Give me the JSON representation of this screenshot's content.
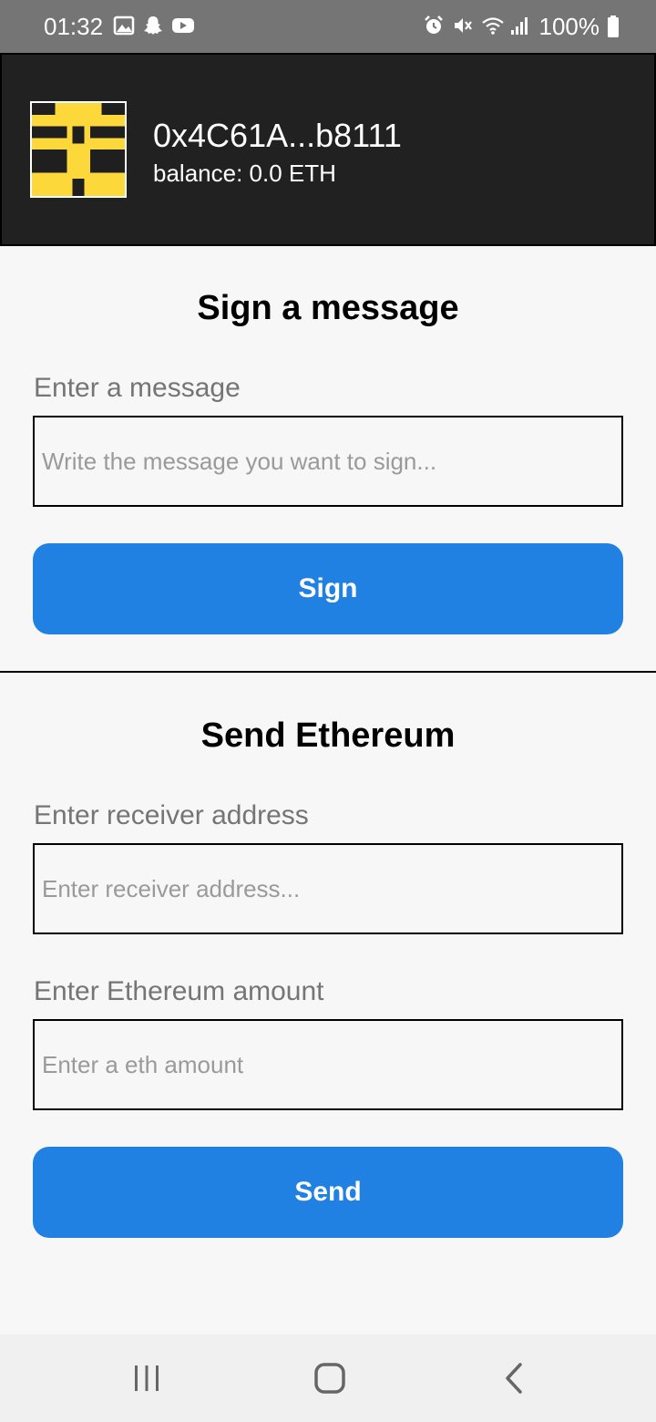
{
  "status_bar": {
    "time": "01:32",
    "battery": "100%",
    "left_icons": [
      "gallery-icon",
      "snapchat-icon",
      "youtube-icon"
    ],
    "right_icons": [
      "alarm-icon",
      "mute-icon",
      "wifi-icon",
      "signal-icon",
      "battery-icon"
    ]
  },
  "wallet": {
    "address": "0x4C61A...b8111",
    "balance": "balance: 0.0 ETH",
    "avatar_colors": [
      "#fcd83a",
      "#1f1f1f"
    ]
  },
  "sign": {
    "title": "Sign a message",
    "label": "Enter a message",
    "placeholder": "Write the message you want to sign...",
    "button": "Sign"
  },
  "send": {
    "title": "Send Ethereum",
    "receiver_label": "Enter receiver address",
    "receiver_placeholder": "Enter receiver address...",
    "amount_label": "Enter Ethereum amount",
    "amount_placeholder": "Enter a eth amount",
    "button": "Send"
  },
  "nav_bar": {
    "buttons": [
      "recent-apps-icon",
      "home-icon",
      "back-icon"
    ]
  },
  "colors": {
    "accent": "#2181e2",
    "header_bg": "#212121",
    "status_bar_bg": "#757575",
    "page_bg": "#f7f7f7"
  }
}
